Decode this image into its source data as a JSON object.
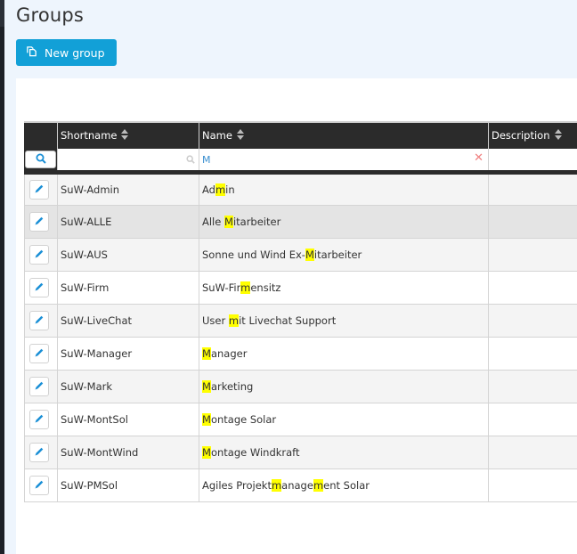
{
  "page": {
    "title": "Groups",
    "new_button_label": "New group",
    "new_button_icon": "copy-icon"
  },
  "colors": {
    "accent": "#12a0d7",
    "header_bg": "#2b2b2b",
    "highlight": "#ffff00",
    "clear_icon": "#f08080"
  },
  "table": {
    "columns": [
      {
        "key": "edit",
        "label": ""
      },
      {
        "key": "shortname",
        "label": "Shortname",
        "sortable": true
      },
      {
        "key": "name",
        "label": "Name",
        "sortable": true
      },
      {
        "key": "description",
        "label": "Description",
        "sortable": true
      }
    ],
    "filters": {
      "shortname": {
        "value": "",
        "placeholder": ""
      },
      "name": {
        "value": "M",
        "placeholder": ""
      }
    },
    "highlight_term": "M",
    "rows": [
      {
        "shortname": "SuW-Admin",
        "name": "Admin",
        "name_parts": [
          "Ad",
          "m",
          "in"
        ],
        "description": "",
        "state": "odd"
      },
      {
        "shortname": "SuW-ALLE",
        "name": "Alle Mitarbeiter",
        "name_parts": [
          "Alle ",
          "M",
          "itarbeiter"
        ],
        "description": "",
        "state": "hover"
      },
      {
        "shortname": "SuW-AUS",
        "name": "Sonne und Wind Ex-Mitarbeiter",
        "name_parts": [
          "Sonne und Wind Ex-",
          "M",
          "itarbeiter"
        ],
        "description": "",
        "state": "odd"
      },
      {
        "shortname": "SuW-Firm",
        "name": "SuW-Firmensitz",
        "name_parts": [
          "SuW-Fir",
          "m",
          "ensitz"
        ],
        "description": "",
        "state": "even"
      },
      {
        "shortname": "SuW-LiveChat",
        "name": "User mit Livechat Support",
        "name_parts": [
          "User ",
          "m",
          "it Livechat Support"
        ],
        "description": "",
        "state": "odd"
      },
      {
        "shortname": "SuW-Manager",
        "name": "Manager",
        "name_parts": [
          "",
          "M",
          "anager"
        ],
        "description": "",
        "state": "even"
      },
      {
        "shortname": "SuW-Mark",
        "name": "Marketing",
        "name_parts": [
          "",
          "M",
          "arketing"
        ],
        "description": "",
        "state": "odd"
      },
      {
        "shortname": "SuW-MontSol",
        "name": "Montage Solar",
        "name_parts": [
          "",
          "M",
          "ontage Solar"
        ],
        "description": "",
        "state": "even"
      },
      {
        "shortname": "SuW-MontWind",
        "name": "Montage Windkraft",
        "name_parts": [
          "",
          "M",
          "ontage Windkraft"
        ],
        "description": "",
        "state": "odd"
      },
      {
        "shortname": "SuW-PMSol",
        "name": "Agiles Projektmanagement Solar",
        "name_parts": [
          "Agiles Projekt",
          "m",
          "anage",
          "m",
          "ent Solar"
        ],
        "description": "",
        "state": "even"
      }
    ]
  }
}
